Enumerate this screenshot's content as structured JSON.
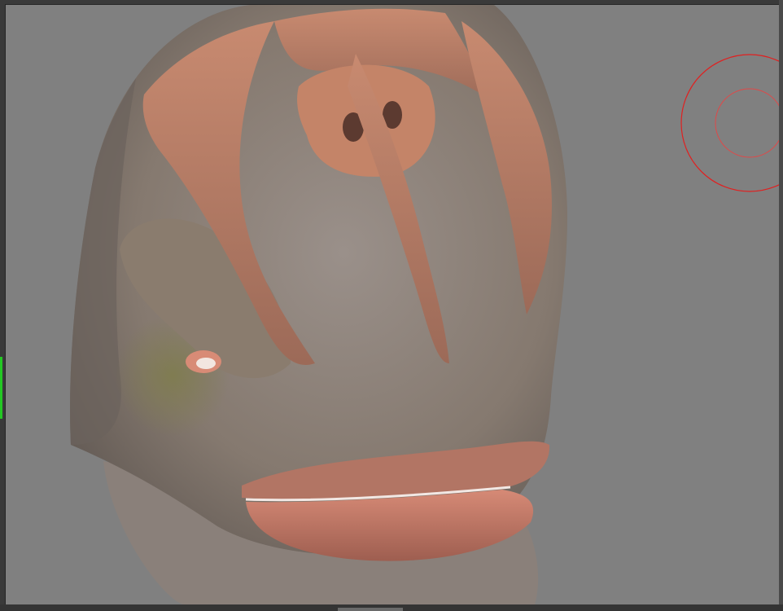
{
  "app": {
    "viewport_background": "#808080",
    "frame_color": "#3a3a3a",
    "selection_indicator_color": "#23c823"
  },
  "viewport": {
    "content": "3d-model-render",
    "model_colors": {
      "skin_gray": "#8e8580",
      "skin_dark": "#6b625d",
      "plates_orange": "#b77a62",
      "plates_highlight": "#d39a7f",
      "lip": "#c07a68",
      "eye_rim": "#d88b76",
      "cheek_green": "#7c7a4f"
    },
    "brush_cursor": {
      "outer_color": "#e02020",
      "inner_color": "#e04848"
    }
  }
}
